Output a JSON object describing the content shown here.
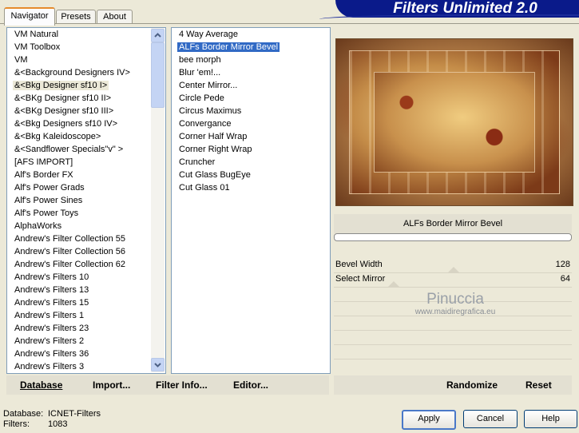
{
  "tabs": [
    "Navigator",
    "Presets",
    "About"
  ],
  "banner_title": "Filters Unlimited 2.0",
  "categories": [
    "VM Natural",
    "VM Toolbox",
    "VM",
    "&<Background Designers IV>",
    "&<Bkg Designer sf10 I>",
    "&<BKg Designer sf10 II>",
    "&<BKg Designer sf10 III>",
    "&<Bkg Designers sf10 IV>",
    "&<Bkg Kaleidoscope>",
    "&<Sandflower Specials\"v\" >",
    "[AFS IMPORT]",
    "Alf's Border FX",
    "Alf's Power Grads",
    "Alf's Power Sines",
    "Alf's Power Toys",
    "AlphaWorks",
    "Andrew's Filter Collection 55",
    "Andrew's Filter Collection 56",
    "Andrew's Filter Collection 62",
    "Andrew's Filters 10",
    "Andrew's Filters 13",
    "Andrew's Filters 15",
    "Andrew's Filters 1",
    "Andrew's Filters 23",
    "Andrew's Filters 2",
    "Andrew's Filters 36",
    "Andrew's Filters 3"
  ],
  "filters": [
    "4 Way Average",
    "ALFs Border Mirror Bevel",
    "bee morph",
    "Blur 'em!...",
    "Center Mirror...",
    "Circle Pede",
    "Circus Maximus",
    "Convergance",
    "Corner Half Wrap",
    "Corner Right Wrap",
    "Cruncher",
    "Cut Glass  BugEye",
    "Cut Glass 01"
  ],
  "selected_filter_name": "ALFs Border Mirror Bevel",
  "params": [
    {
      "label": "Bevel Width",
      "value": "128"
    },
    {
      "label": "Select Mirror",
      "value": "64"
    }
  ],
  "watermark": {
    "name": "Pinuccia",
    "site": "www.maidiregrafica.eu"
  },
  "left_buttons": [
    "Database",
    "Import...",
    "Filter Info...",
    "Editor..."
  ],
  "right_buttons": [
    "Randomize",
    "Reset"
  ],
  "info": {
    "database_label": "Database:",
    "database_value": "ICNET-Filters",
    "filters_label": "Filters:",
    "filters_value": "1083"
  },
  "dialog_buttons": [
    "Apply",
    "Cancel",
    "Help"
  ]
}
